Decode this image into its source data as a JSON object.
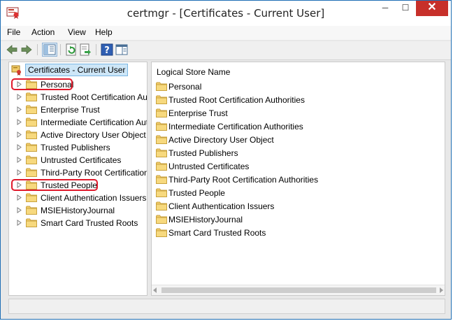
{
  "window": {
    "title": "certmgr - [Certificates - Current User]",
    "buttons": {
      "minimize": "─",
      "maximize": "☐",
      "close": "✕"
    }
  },
  "menu": [
    "File",
    "Action",
    "View",
    "Help"
  ],
  "tree": {
    "root": "Certificates - Current User",
    "items": [
      "Personal",
      "Trusted Root Certification Authorities",
      "Enterprise Trust",
      "Intermediate Certification Authorities",
      "Active Directory User Object",
      "Trusted Publishers",
      "Untrusted Certificates",
      "Third-Party Root Certification Authorities",
      "Trusted People",
      "Client Authentication Issuers",
      "MSIEHistoryJournal",
      "Smart Card Trusted Roots"
    ],
    "highlighted": [
      "Personal",
      "Trusted People"
    ]
  },
  "list": {
    "column": "Logical Store Name",
    "items": [
      "Personal",
      "Trusted Root Certification Authorities",
      "Enterprise Trust",
      "Intermediate Certification Authorities",
      "Active Directory User Object",
      "Trusted Publishers",
      "Untrusted Certificates",
      "Third-Party Root Certification Authorities",
      "Trusted People",
      "Client Authentication Issuers",
      "MSIEHistoryJournal",
      "Smart Card Trusted Roots"
    ]
  },
  "colors": {
    "highlight": "#e0192b",
    "selection": "#cde6f7",
    "folder": "#f2cc6a",
    "close": "#c7302a"
  }
}
